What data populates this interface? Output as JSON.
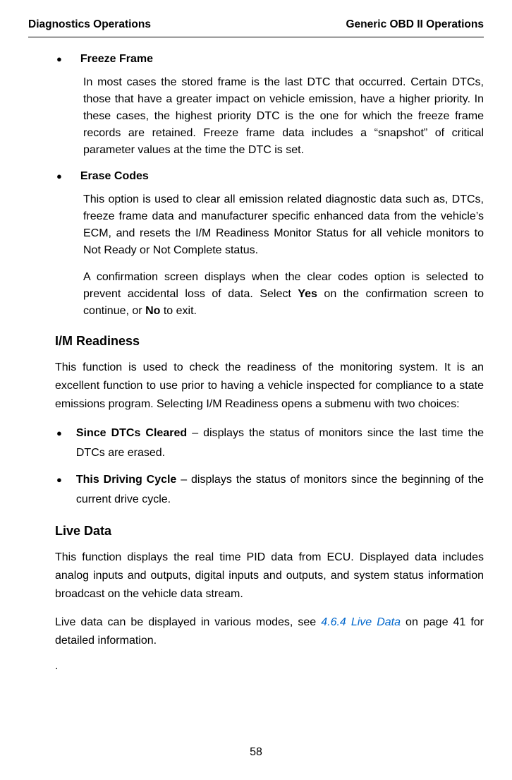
{
  "header": {
    "left": "Diagnostics Operations",
    "right": "Generic OBD II Operations"
  },
  "section1": {
    "bullet1_title": "Freeze Frame",
    "bullet1_body": "In most cases the stored frame is the last DTC that occurred. Certain DTCs, those that have a greater impact on vehicle emission, have a higher priority. In these cases, the highest priority DTC is the one for which the freeze frame records are retained. Freeze frame data includes a “snapshot” of critical parameter values at the time the DTC is set.",
    "bullet2_title": "Erase Codes",
    "bullet2_body1": "This option is used to clear all emission related diagnostic data such as, DTCs, freeze frame data and manufacturer specific enhanced data from the vehicle’s ECM, and resets the I/M Readiness Monitor Status for all vehicle monitors to Not Ready or Not Complete status.",
    "bullet2_body2_pre": "A confirmation screen displays when the clear codes option is selected to prevent accidental loss of data. Select ",
    "bullet2_body2_yes": "Yes",
    "bullet2_body2_mid": " on the confirmation screen to continue, or ",
    "bullet2_body2_no": "No",
    "bullet2_body2_post": " to exit."
  },
  "section2": {
    "title": "I/M Readiness",
    "intro": "This function is used to check the readiness of the monitoring system. It is an excellent function to use prior to having a vehicle inspected for compliance to a state emissions program. Selecting I/M Readiness opens a submenu with two choices:",
    "b1_label": "Since DTCs Cleared",
    "b1_rest": " – displays the status of monitors since the last time the DTCs are erased.",
    "b2_label": "This Driving Cycle",
    "b2_rest": " – displays the status of monitors since the beginning of the current drive cycle."
  },
  "section3": {
    "title": "Live Data",
    "p1": "This function displays the real time PID data from ECU. Displayed data includes analog inputs and outputs, digital inputs and outputs, and system status information broadcast on the vehicle data stream.",
    "p2_pre": "Live data can be displayed in various modes, see ",
    "p2_xref": "4.6.4 Live Data",
    "p2_post": " on page 41 for detailed information.",
    "dot": "."
  },
  "page_number": "58"
}
